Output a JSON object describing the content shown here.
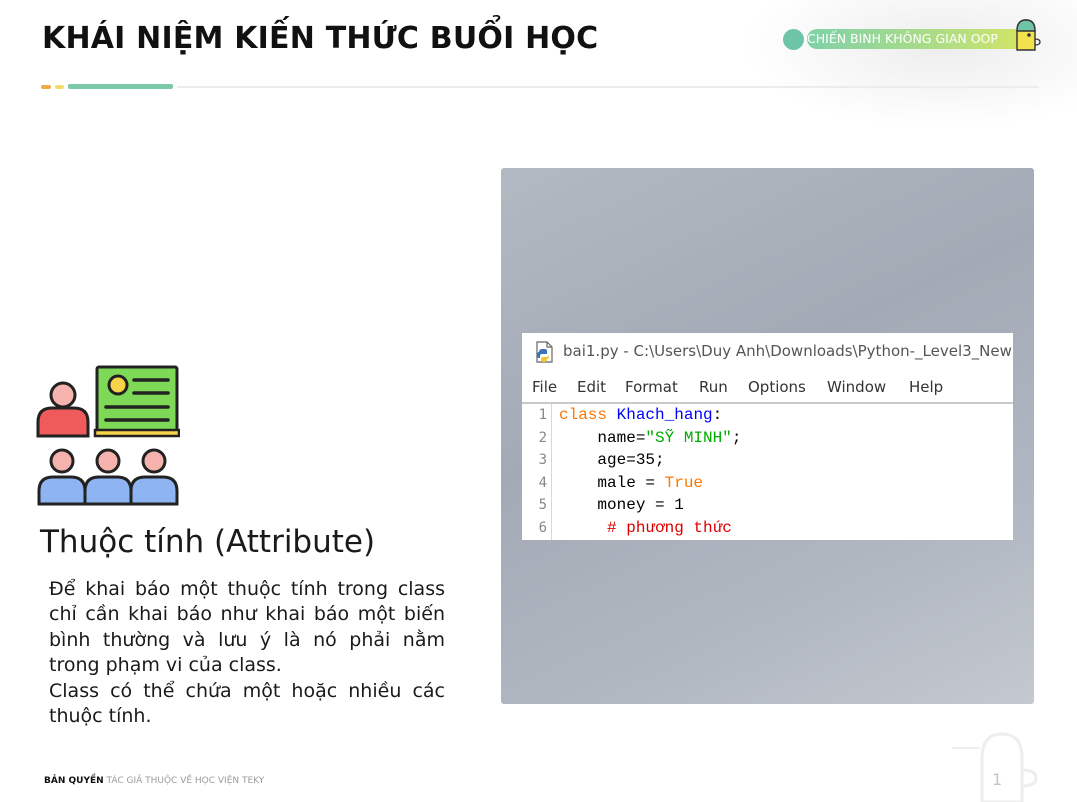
{
  "slide": {
    "title": "KHÁI NIỆM KIẾN THỨC BUỔI HỌC",
    "badge_text": "CHIẾN BINH KHÔNG GIAN OOP",
    "section_heading": "Thuộc tính (Attribute)",
    "description": [
      "Để khai báo một thuộc tính trong class chỉ cần khai báo như khai báo một biến bình thường và lưu ý là nó phải nằm trong phạm vi của class.",
      "Class có thể chứa một hoặc nhiều các thuộc tính."
    ],
    "page_number": "1"
  },
  "ide": {
    "window_title": "bai1.py - C:\\Users\\Duy Anh\\Downloads\\Python-_Level3_New",
    "menu": [
      "File",
      "Edit",
      "Format",
      "Run",
      "Options",
      "Window",
      "Help"
    ],
    "line_numbers": [
      "1",
      "2",
      "3",
      "4",
      "5",
      "6"
    ],
    "code": {
      "l1_kw": "class",
      "l1_name": "Khach_hang",
      "l1_end": ":",
      "l2_lhs": "    name=",
      "l2_str": "\"SỸ MINH\"",
      "l2_end": ";",
      "l3": "    age=35;",
      "l4_lhs": "    male = ",
      "l4_kw": "True",
      "l5": "    money = 1",
      "l6_indent": "     ",
      "l6_cmt": "# phương thức"
    }
  },
  "footer": {
    "strong": "BẢN QUYỀN",
    "light": "TÁC GIẢ THUỘC VỀ HỌC VIỆN TEKY"
  },
  "colors": {
    "accent_green": "#7cc9a9",
    "panel_gray": "#a3aab5",
    "keyword_orange": "#ff7700",
    "class_blue": "#0000ff",
    "string_green": "#00aa00",
    "comment_red": "#dd0000"
  },
  "icons": {
    "people": "presentation-people-icon",
    "python": "python-file-icon",
    "mascot": "teky-mascot-icon"
  }
}
